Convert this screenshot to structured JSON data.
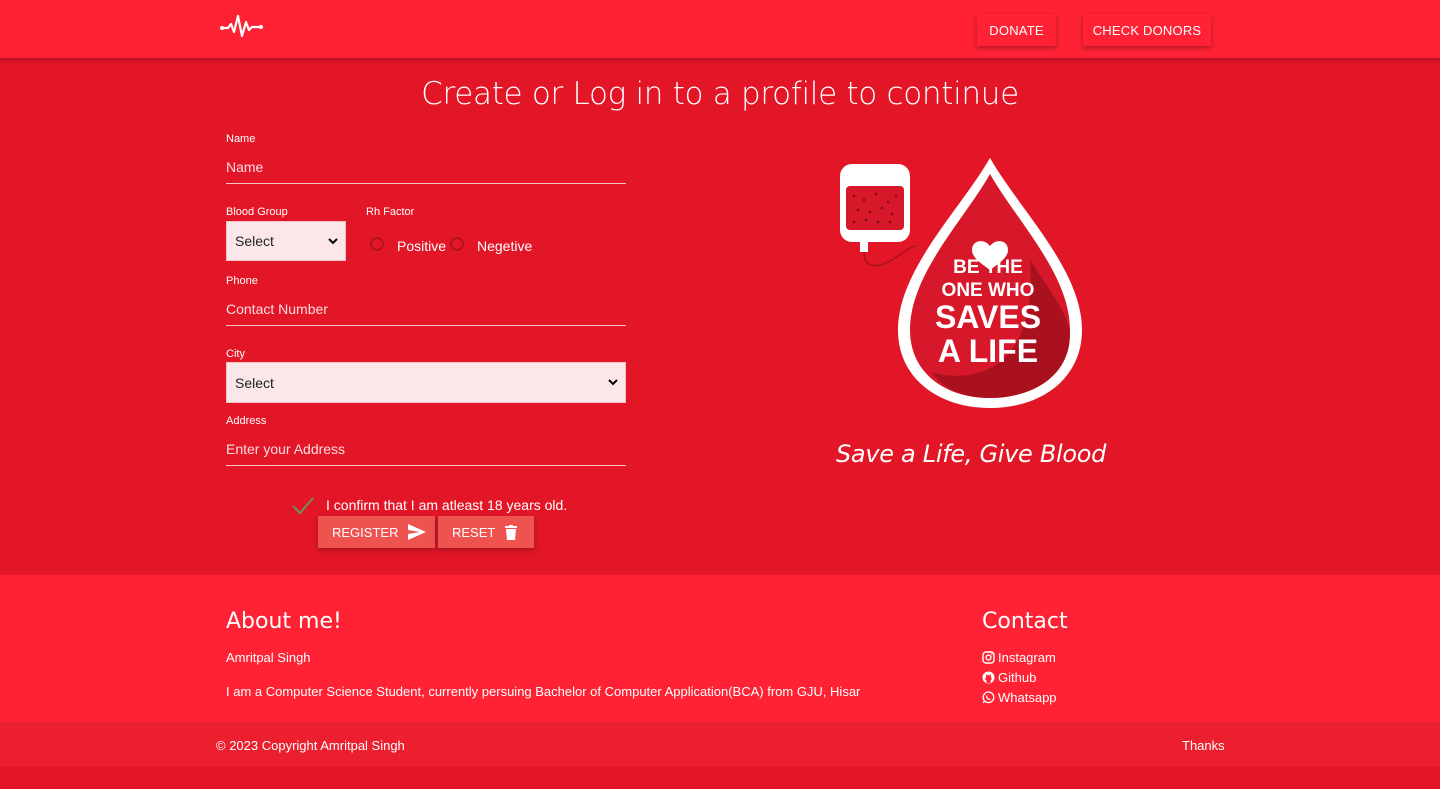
{
  "nav": {
    "logo_icon": "heartbeat-icon",
    "donate_label": "DONATE",
    "check_donors_label": "CHECK DONORS"
  },
  "page": {
    "title": "Create or Log in to a profile to continue"
  },
  "form": {
    "name_label": "Name",
    "name_placeholder": "Name",
    "blood_group_label": "Blood Group",
    "blood_group_value": "Select",
    "rh_label": "Rh Factor",
    "rh_options": [
      "Positive",
      "Negetive"
    ],
    "phone_label": "Phone",
    "phone_placeholder": "Contact Number",
    "city_label": "City",
    "city_value": "Select",
    "address_label": "Address",
    "address_placeholder": "Enter your Address",
    "confirm_text": "I confirm that I am atleast 18 years old.",
    "register_label": "REGISTER",
    "reset_label": "RESET"
  },
  "hero": {
    "badge_lines": [
      "BE THE",
      "ONE WHO",
      "SAVES",
      "A LIFE"
    ],
    "tagline": "Save a Life, Give Blood"
  },
  "footer": {
    "about_title": "About me!",
    "about_name": "Amritpal Singh",
    "about_desc": "I am a Computer Science Student, currently persuing Bachelor of Computer Application(BCA) from GJU, Hisar",
    "contact_title": "Contact",
    "links": [
      "Instagram",
      "Github",
      "Whatsapp"
    ],
    "copyright": "© 2023 Copyright Amritpal Singh",
    "thanks": "Thanks"
  },
  "colors": {
    "primary": "#fe2234",
    "background": "#e31628",
    "button": "#ef5350"
  }
}
